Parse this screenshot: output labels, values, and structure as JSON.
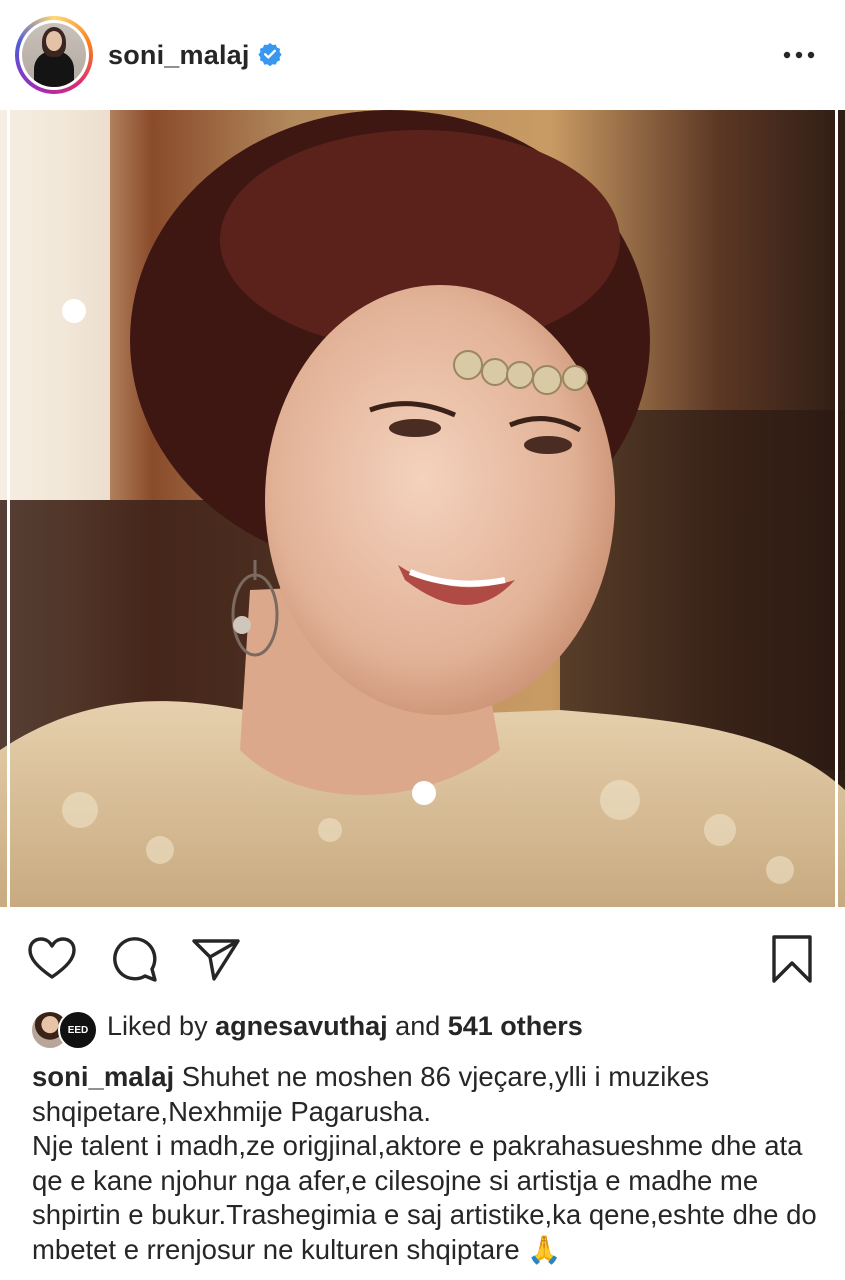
{
  "post": {
    "username": "soni_malaj",
    "verified": true,
    "more_icon": "more-horizontal-icon"
  },
  "actions": {
    "like_icon": "heart-icon",
    "comment_icon": "comment-icon",
    "share_icon": "send-icon",
    "save_icon": "bookmark-icon"
  },
  "likes": {
    "prefix": "Liked by",
    "user": "agnesavuthaj",
    "middle": "and",
    "others": "541 others",
    "second_avatar_text": "EED"
  },
  "caption": {
    "username": "soni_malaj",
    "line1": "Shuhet ne moshen 86 vjeçare,ylli i muzikes shqipetare,Nexhmije Pagarusha.",
    "line2": "Nje talent i madh,ze origjinal,aktore e pakrahasueshme dhe ata qe e kane njohur nga afer,e cilesojne si artistja e madhe me shpirtin e bukur.Trashegimia e saj artistike,ka qene,eshte dhe do mbetet e rrenjosur ne kulturen shqiptare",
    "emoji": "🙏"
  },
  "colors": {
    "verified_blue": "#3897f0",
    "text": "#262626"
  }
}
